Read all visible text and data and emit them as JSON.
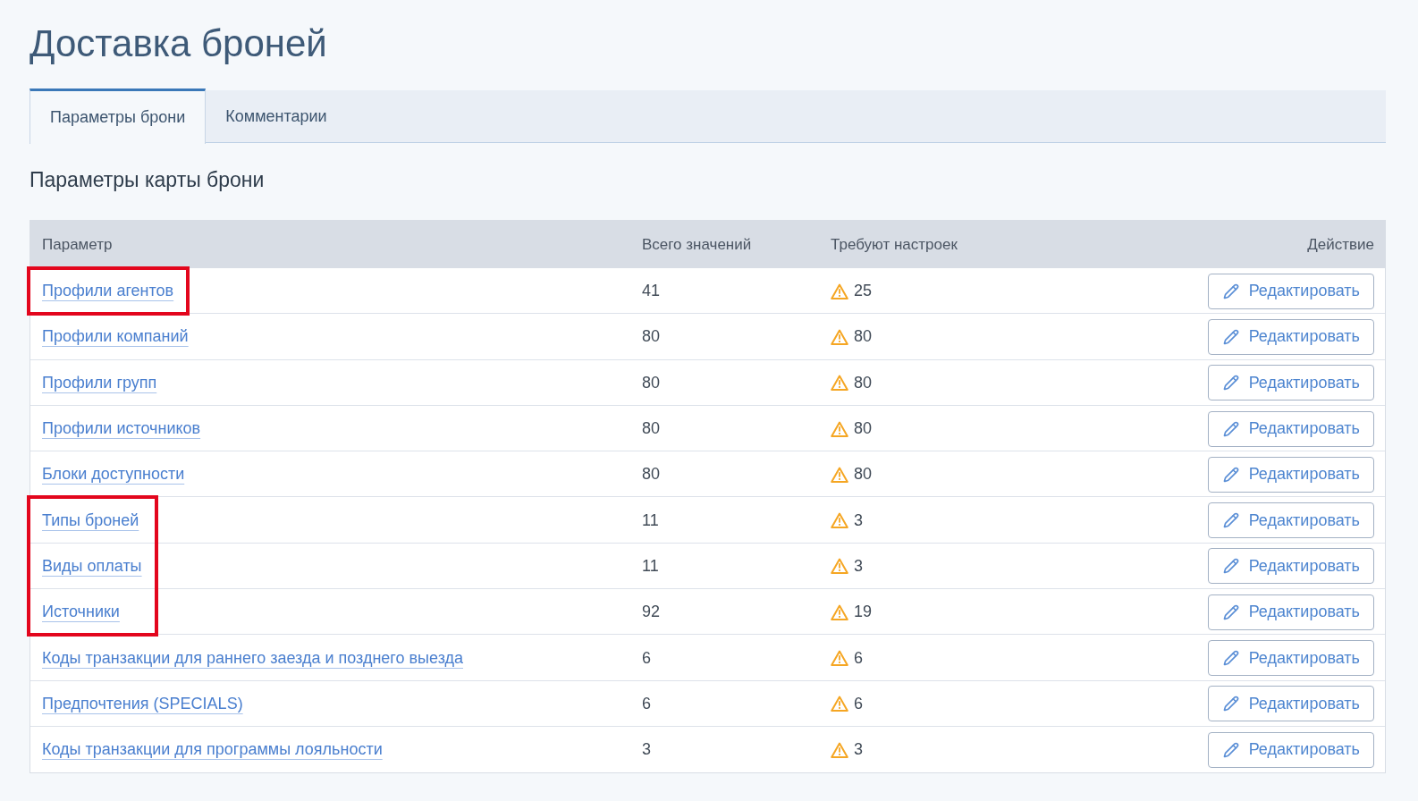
{
  "page": {
    "title": "Доставка броней"
  },
  "tabs": [
    {
      "label": "Параметры брони",
      "selected": true
    },
    {
      "label": "Комментарии",
      "selected": false
    }
  ],
  "section": {
    "title": "Параметры карты брони"
  },
  "table": {
    "columns": [
      "Параметр",
      "Всего значений",
      "Требуют настроек",
      "Действие"
    ],
    "rows": [
      {
        "parameter": "Профили агентов",
        "total": "41",
        "needs_setup": "25",
        "action": "Редактировать",
        "highlighted": true
      },
      {
        "parameter": "Профили компаний",
        "total": "80",
        "needs_setup": "80",
        "action": "Редактировать",
        "highlighted": false
      },
      {
        "parameter": "Профили групп",
        "total": "80",
        "needs_setup": "80",
        "action": "Редактировать",
        "highlighted": false
      },
      {
        "parameter": "Профили источников",
        "total": "80",
        "needs_setup": "80",
        "action": "Редактировать",
        "highlighted": false
      },
      {
        "parameter": "Блоки доступности",
        "total": "80",
        "needs_setup": "80",
        "action": "Редактировать",
        "highlighted": false
      },
      {
        "parameter": "Типы броней",
        "total": "11",
        "needs_setup": "3",
        "action": "Редактировать",
        "highlighted": true
      },
      {
        "parameter": "Виды оплаты",
        "total": "11",
        "needs_setup": "3",
        "action": "Редактировать",
        "highlighted": true
      },
      {
        "parameter": "Источники",
        "total": "92",
        "needs_setup": "19",
        "action": "Редактировать",
        "highlighted": true
      },
      {
        "parameter": "Коды транзакции для раннего заезда и позднего выезда",
        "total": "6",
        "needs_setup": "6",
        "action": "Редактировать",
        "highlighted": false
      },
      {
        "parameter": "Предпочтения (SPECIALS)",
        "total": "6",
        "needs_setup": "6",
        "action": "Редактировать",
        "highlighted": false
      },
      {
        "parameter": "Коды транзакции для программы лояльности",
        "total": "3",
        "needs_setup": "3",
        "action": "Редактировать",
        "highlighted": false
      }
    ]
  }
}
